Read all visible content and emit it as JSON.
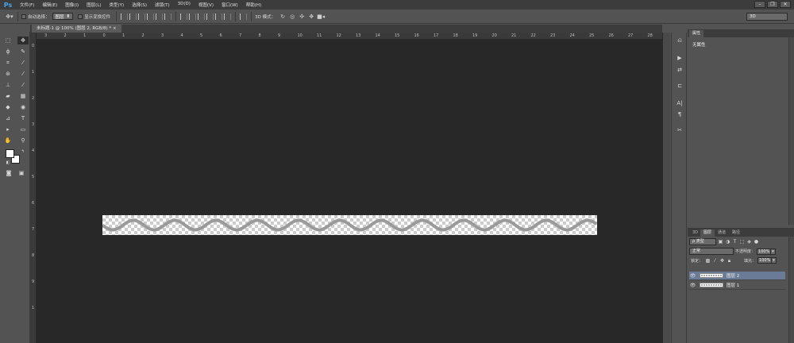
{
  "app": {
    "logo": "Ps"
  },
  "menu": [
    "文件(F)",
    "编辑(E)",
    "图像(I)",
    "图层(L)",
    "类型(Y)",
    "选择(S)",
    "滤镜(T)",
    "3D(D)",
    "视图(V)",
    "窗口(W)",
    "帮助(H)"
  ],
  "window_controls": {
    "minimize": "–",
    "restore": "❐",
    "close": "✕"
  },
  "options": {
    "auto_select_label": "自动选择：",
    "auto_select_value": "图层",
    "show_transform_label": "显示变换控件",
    "mode_3d_label": "3D 模式：",
    "workspace": "3D"
  },
  "document": {
    "tab_title": "未标题-1 @ 100% (图层 2, RGB/8) *",
    "close_label": "×"
  },
  "ruler": {
    "h_ticks": [
      "3",
      "2",
      "1",
      "0",
      "1",
      "2",
      "3",
      "4",
      "5",
      "6",
      "7",
      "8",
      "9",
      "10",
      "11",
      "12",
      "13",
      "14",
      "15",
      "16",
      "17",
      "18",
      "19",
      "20",
      "21",
      "22",
      "23",
      "24",
      "25",
      "26",
      "27",
      "28"
    ],
    "v_ticks": [
      "0",
      "1",
      "2",
      "3",
      "4",
      "5",
      "6",
      "7",
      "8",
      "9",
      "1"
    ]
  },
  "tools": [
    {
      "icon": "marquee-icon",
      "glyph": "⬚"
    },
    {
      "icon": "move-icon",
      "glyph": "✥"
    },
    {
      "icon": "lasso-icon",
      "glyph": "ϕ"
    },
    {
      "icon": "quick-select-icon",
      "glyph": "✎"
    },
    {
      "icon": "crop-icon",
      "glyph": "⌗"
    },
    {
      "icon": "eyedropper-icon",
      "glyph": "⁄"
    },
    {
      "icon": "healing-icon",
      "glyph": "⊛"
    },
    {
      "icon": "brush-icon",
      "glyph": "⁄"
    },
    {
      "icon": "stamp-icon",
      "glyph": "⊥"
    },
    {
      "icon": "history-brush-icon",
      "glyph": "⁄"
    },
    {
      "icon": "eraser-icon",
      "glyph": "▰"
    },
    {
      "icon": "gradient-icon",
      "glyph": "▦"
    },
    {
      "icon": "blur-icon",
      "glyph": "◆"
    },
    {
      "icon": "dodge-icon",
      "glyph": "◉"
    },
    {
      "icon": "pen-icon",
      "glyph": "⊿"
    },
    {
      "icon": "type-icon",
      "glyph": "T"
    },
    {
      "icon": "path-select-icon",
      "glyph": "▸"
    },
    {
      "icon": "shape-icon",
      "glyph": "▭"
    },
    {
      "icon": "hand-icon",
      "glyph": "✋"
    },
    {
      "icon": "zoom-icon",
      "glyph": "⚲"
    }
  ],
  "strip_icons": [
    {
      "icon": "history-icon",
      "glyph": "⎌"
    },
    {
      "icon": "actions-icon",
      "glyph": "▶"
    },
    {
      "icon": "adjust-icon",
      "glyph": "⇄"
    },
    {
      "icon": "align-panel-icon",
      "glyph": "⊏"
    },
    {
      "icon": "character-icon",
      "glyph": "A|"
    },
    {
      "icon": "paragraph-icon",
      "glyph": "¶"
    },
    {
      "icon": "tools-panel-icon",
      "glyph": "✂"
    }
  ],
  "properties": {
    "tab": "属性",
    "content": "无属性"
  },
  "layers": {
    "tabs": [
      "3D",
      "图层",
      "通道",
      "路径"
    ],
    "filter_label": "ρ 类型",
    "blend_mode": "正常",
    "opacity_label": "不透明度：",
    "opacity_value": "100%",
    "lock_label": "锁定：",
    "fill_label": "填充：",
    "fill_value": "100%",
    "items": [
      {
        "name": "图层 2",
        "selected": true
      },
      {
        "name": "图层 1",
        "selected": false
      }
    ]
  }
}
